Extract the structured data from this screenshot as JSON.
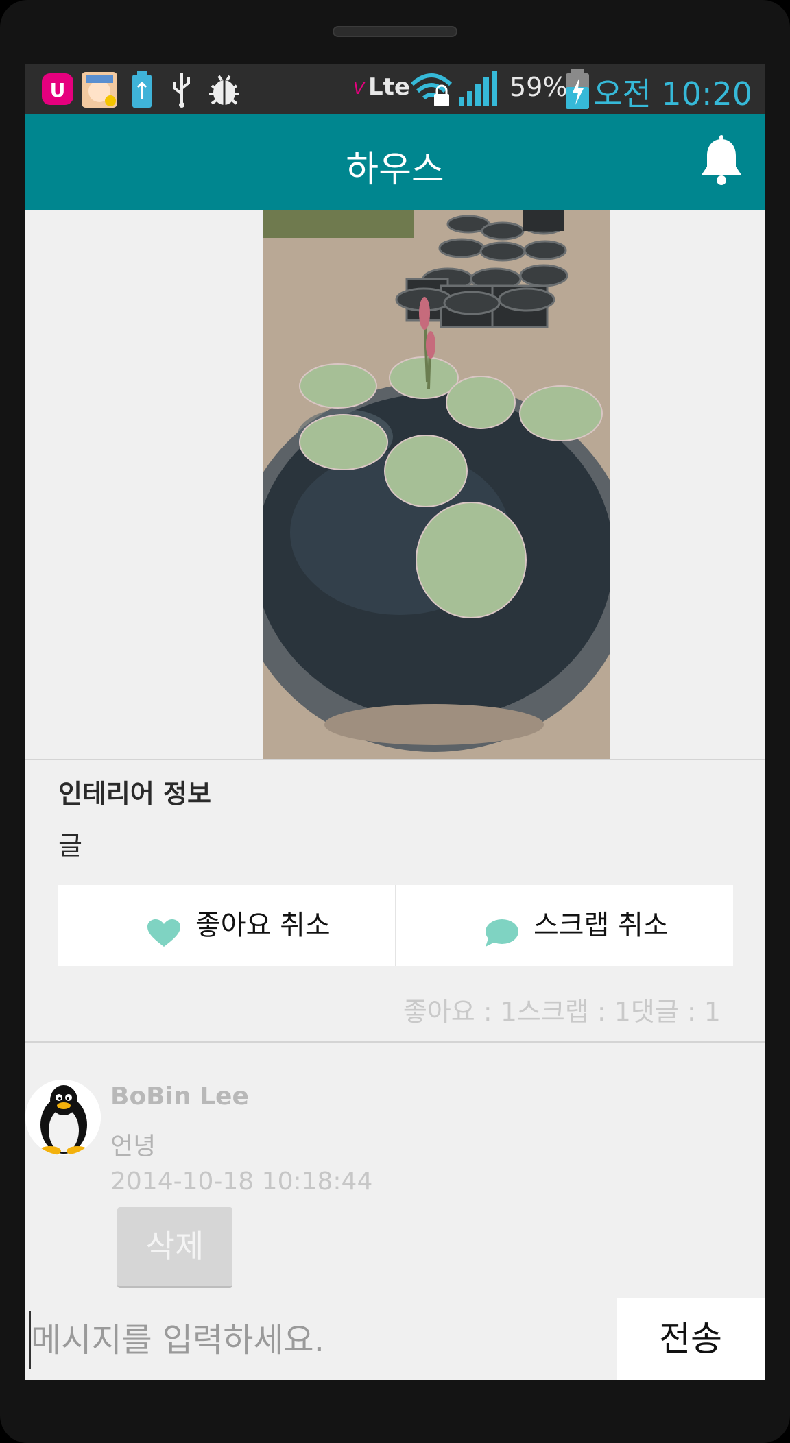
{
  "status_bar": {
    "icons": [
      "uplus-app-icon",
      "character-app-icon",
      "battery-saver-icon",
      "usb-icon",
      "debug-bug-icon"
    ],
    "network_label": "Lte",
    "battery_percent": "59%",
    "time": "오전 10:20"
  },
  "action_bar": {
    "title": "하우스",
    "icon": "bell-icon"
  },
  "post": {
    "title": "인테리어 정보",
    "body": "글",
    "like_button_label": "좋아요 취소",
    "scrap_button_label": "스크랩 취소",
    "stats_text": "좋아요 : 1스크랩 : 1댓글 : 1",
    "like_icon": "heart-icon",
    "scrap_icon": "speech-bubble-icon"
  },
  "comment": {
    "author": "BoBin  Lee",
    "text": "언녕",
    "timestamp": "2014-10-18 10:18:44",
    "delete_label": "삭제"
  },
  "composer": {
    "placeholder": "메시지를 입력하세요.",
    "send_label": "전송"
  },
  "colors": {
    "action_bar": "#00868f",
    "accent_icon": "#7fd3c2",
    "clock": "#36b9d8"
  }
}
